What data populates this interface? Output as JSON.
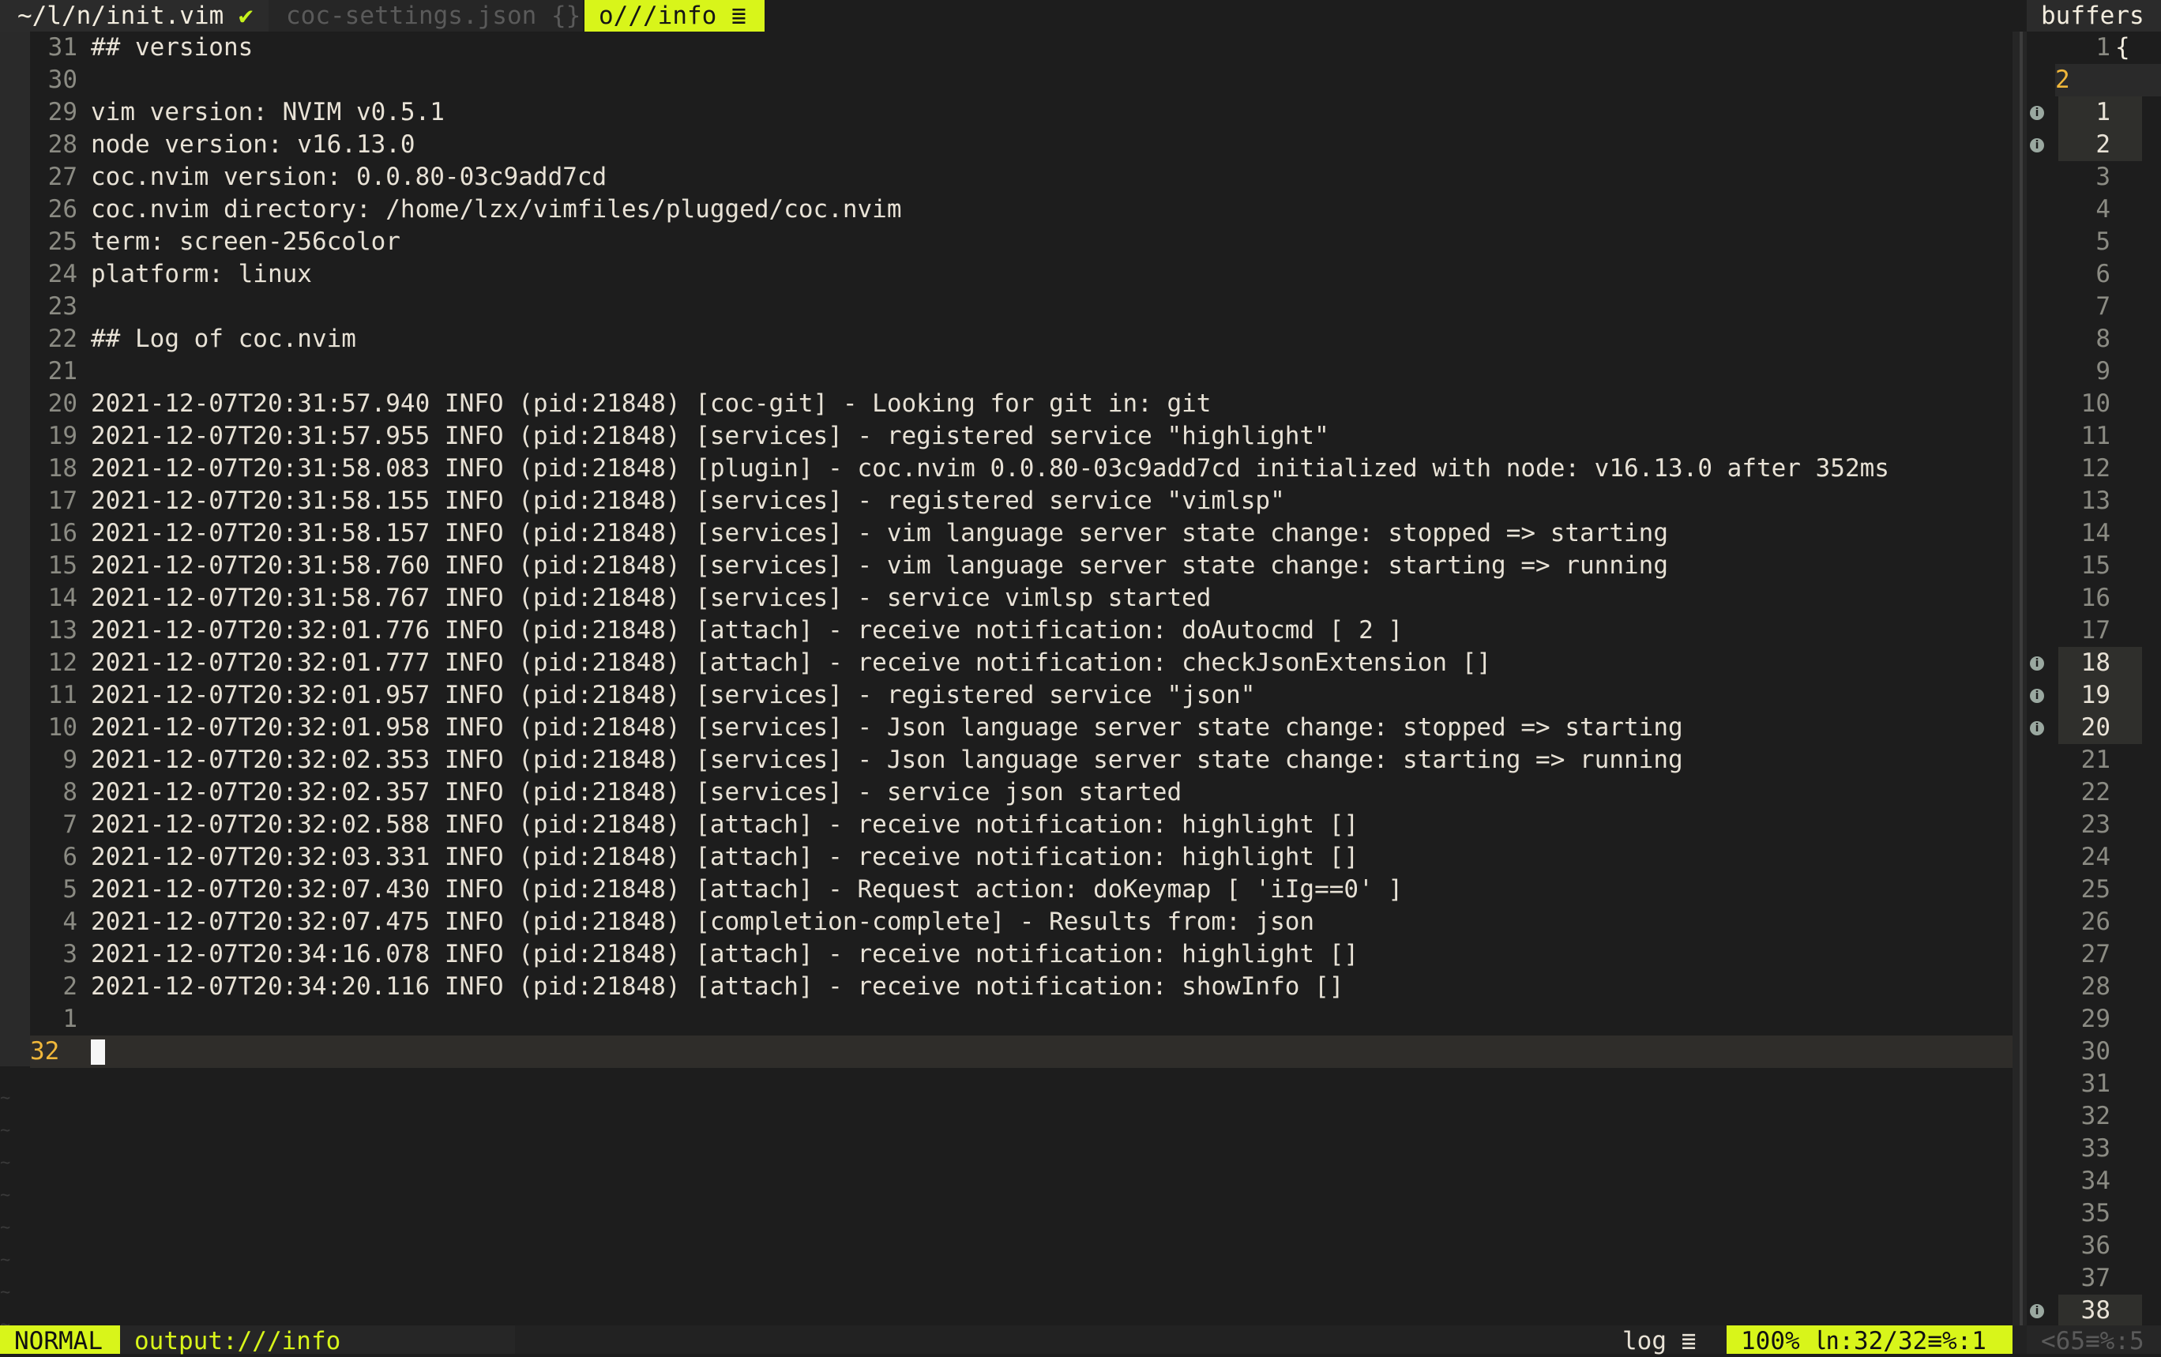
{
  "tabline": {
    "tab1_label": "~/l/n/init.vim",
    "tab1_mark": "✔",
    "tab2_label": "coc-settings.json {}",
    "tab3_label": "o///info ≣",
    "buffers_label": "buffers"
  },
  "main": {
    "lines": [
      {
        "num": "31",
        "text": "## versions"
      },
      {
        "num": "30",
        "text": ""
      },
      {
        "num": "29",
        "text": "vim version: NVIM v0.5.1"
      },
      {
        "num": "28",
        "text": "node version: v16.13.0"
      },
      {
        "num": "27",
        "text": "coc.nvim version: 0.0.80-03c9add7cd"
      },
      {
        "num": "26",
        "text": "coc.nvim directory: /home/lzx/vimfiles/plugged/coc.nvim"
      },
      {
        "num": "25",
        "text": "term: screen-256color"
      },
      {
        "num": "24",
        "text": "platform: linux"
      },
      {
        "num": "23",
        "text": ""
      },
      {
        "num": "22",
        "text": "## Log of coc.nvim"
      },
      {
        "num": "21",
        "text": ""
      },
      {
        "num": "20",
        "text": "2021-12-07T20:31:57.940 INFO (pid:21848) [coc-git] - Looking for git in: git"
      },
      {
        "num": "19",
        "text": "2021-12-07T20:31:57.955 INFO (pid:21848) [services] - registered service \"highlight\""
      },
      {
        "num": "18",
        "text": "2021-12-07T20:31:58.083 INFO (pid:21848) [plugin] - coc.nvim 0.0.80-03c9add7cd initialized with node: v16.13.0 after 352ms"
      },
      {
        "num": "17",
        "text": "2021-12-07T20:31:58.155 INFO (pid:21848) [services] - registered service \"vimlsp\""
      },
      {
        "num": "16",
        "text": "2021-12-07T20:31:58.157 INFO (pid:21848) [services] - vim language server state change: stopped => starting"
      },
      {
        "num": "15",
        "text": "2021-12-07T20:31:58.760 INFO (pid:21848) [services] - vim language server state change: starting => running"
      },
      {
        "num": "14",
        "text": "2021-12-07T20:31:58.767 INFO (pid:21848) [services] - service vimlsp started"
      },
      {
        "num": "13",
        "text": "2021-12-07T20:32:01.776 INFO (pid:21848) [attach] - receive notification: doAutocmd [ 2 ]"
      },
      {
        "num": "12",
        "text": "2021-12-07T20:32:01.777 INFO (pid:21848) [attach] - receive notification: checkJsonExtension []"
      },
      {
        "num": "11",
        "text": "2021-12-07T20:32:01.957 INFO (pid:21848) [services] - registered service \"json\""
      },
      {
        "num": "10",
        "text": "2021-12-07T20:32:01.958 INFO (pid:21848) [services] - Json language server state change: stopped => starting"
      },
      {
        "num": "9",
        "text": "2021-12-07T20:32:02.353 INFO (pid:21848) [services] - Json language server state change: starting => running"
      },
      {
        "num": "8",
        "text": "2021-12-07T20:32:02.357 INFO (pid:21848) [services] - service json started"
      },
      {
        "num": "7",
        "text": "2021-12-07T20:32:02.588 INFO (pid:21848) [attach] - receive notification: highlight []"
      },
      {
        "num": "6",
        "text": "2021-12-07T20:32:03.331 INFO (pid:21848) [attach] - receive notification: highlight []"
      },
      {
        "num": "5",
        "text": "2021-12-07T20:32:07.430 INFO (pid:21848) [attach] - Request action: doKeymap [ 'iIg==0' ]"
      },
      {
        "num": "4",
        "text": "2021-12-07T20:32:07.475 INFO (pid:21848) [completion-complete] - Results from: json"
      },
      {
        "num": "3",
        "text": "2021-12-07T20:34:16.078 INFO (pid:21848) [attach] - receive notification: highlight []"
      },
      {
        "num": "2",
        "text": "2021-12-07T20:34:20.116 INFO (pid:21848) [attach] - receive notification: showInfo []"
      },
      {
        "num": "1",
        "text": ""
      }
    ],
    "cursor_line_num": "32",
    "tilde": "~"
  },
  "side": {
    "first_num": "1",
    "first_text": "{",
    "cursor_num": "2",
    "lines": [
      {
        "num": "1",
        "info": true,
        "hl": true
      },
      {
        "num": "2",
        "info": true,
        "hl": true
      },
      {
        "num": "3"
      },
      {
        "num": "4"
      },
      {
        "num": "5"
      },
      {
        "num": "6"
      },
      {
        "num": "7"
      },
      {
        "num": "8"
      },
      {
        "num": "9"
      },
      {
        "num": "10"
      },
      {
        "num": "11"
      },
      {
        "num": "12"
      },
      {
        "num": "13"
      },
      {
        "num": "14"
      },
      {
        "num": "15"
      },
      {
        "num": "16"
      },
      {
        "num": "17"
      },
      {
        "num": "18",
        "info": true,
        "hl": true
      },
      {
        "num": "19",
        "info": true,
        "hl": true
      },
      {
        "num": "20",
        "info": true,
        "hl": true
      },
      {
        "num": "21"
      },
      {
        "num": "22"
      },
      {
        "num": "23"
      },
      {
        "num": "24"
      },
      {
        "num": "25"
      },
      {
        "num": "26"
      },
      {
        "num": "27"
      },
      {
        "num": "28"
      },
      {
        "num": "29"
      },
      {
        "num": "30"
      },
      {
        "num": "31"
      },
      {
        "num": "32"
      },
      {
        "num": "33"
      },
      {
        "num": "34"
      },
      {
        "num": "35"
      },
      {
        "num": "36"
      },
      {
        "num": "37"
      },
      {
        "num": "38",
        "info": true,
        "hl": true
      }
    ]
  },
  "statusline": {
    "mode": "NORMAL",
    "file": "output:///info",
    "filetype": "log ≣",
    "position": "100% ㏑:32/32≡%:1",
    "side": "<65≡%:5"
  }
}
